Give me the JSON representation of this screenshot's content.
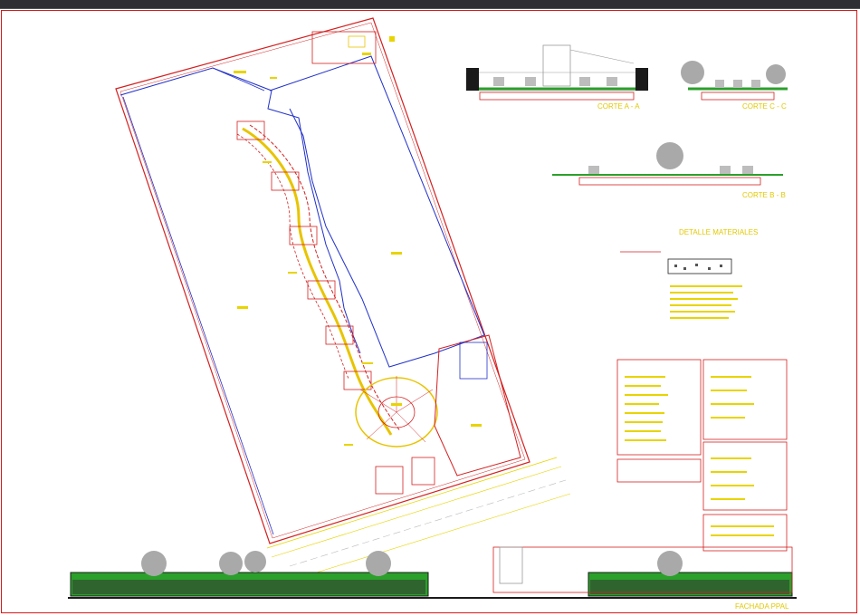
{
  "drawing": {
    "sections": {
      "corte_aa": "CORTE A - A",
      "corte_cc": "CORTE C - C",
      "corte_bb": "CORTE B - B"
    },
    "details_title": "DETALLE MATERIALES",
    "elevation_title": "FACHADA PPAL"
  },
  "colors": {
    "plot_outline": "#d42020",
    "building_line": "#2030c8",
    "annotation": "#e8d400",
    "vegetation": "#2ba02b",
    "tree": "#a9a9a9",
    "sheet_border": "#d21a1a"
  }
}
